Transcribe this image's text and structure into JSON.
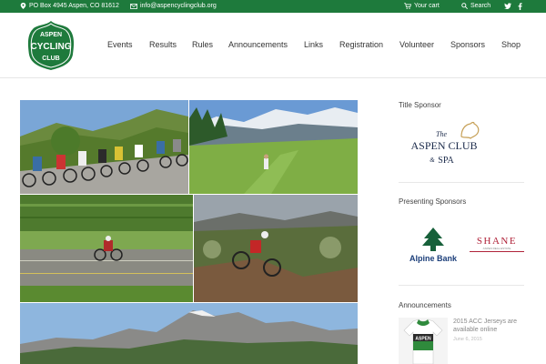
{
  "topbar": {
    "address": "PO Box 4945 Aspen, CO 81612",
    "email": "info@aspencyclingclub.org",
    "cart_label": "Your cart",
    "search_label": "Search"
  },
  "brand": {
    "logo_line1": "ASPEN",
    "logo_line2": "CYCLING",
    "logo_line3": "CLUB",
    "green": "#1e7a3c"
  },
  "nav": {
    "items": [
      {
        "label": "Events"
      },
      {
        "label": "Results"
      },
      {
        "label": "Rules"
      },
      {
        "label": "Announcements"
      },
      {
        "label": "Links"
      },
      {
        "label": "Registration"
      },
      {
        "label": "Volunteer"
      },
      {
        "label": "Sponsors"
      },
      {
        "label": "Shop"
      }
    ]
  },
  "sidebar": {
    "title_sponsor_heading": "Title Sponsor",
    "title_sponsor": {
      "the": "The",
      "name": "ASPEN CLUB",
      "amp": "&",
      "spa": "SPA"
    },
    "presenting_heading": "Presenting Sponsors",
    "presenting": {
      "alpine": "Alpine Bank",
      "shane": "SHANE",
      "shane_sub": "ASPEN REAL ESTATE"
    },
    "announcements_heading": "Announcements",
    "announcement": {
      "title": "2015 ACC Jerseys are available online",
      "date": "June 6, 2015",
      "jersey_text": "ASPEN"
    }
  }
}
